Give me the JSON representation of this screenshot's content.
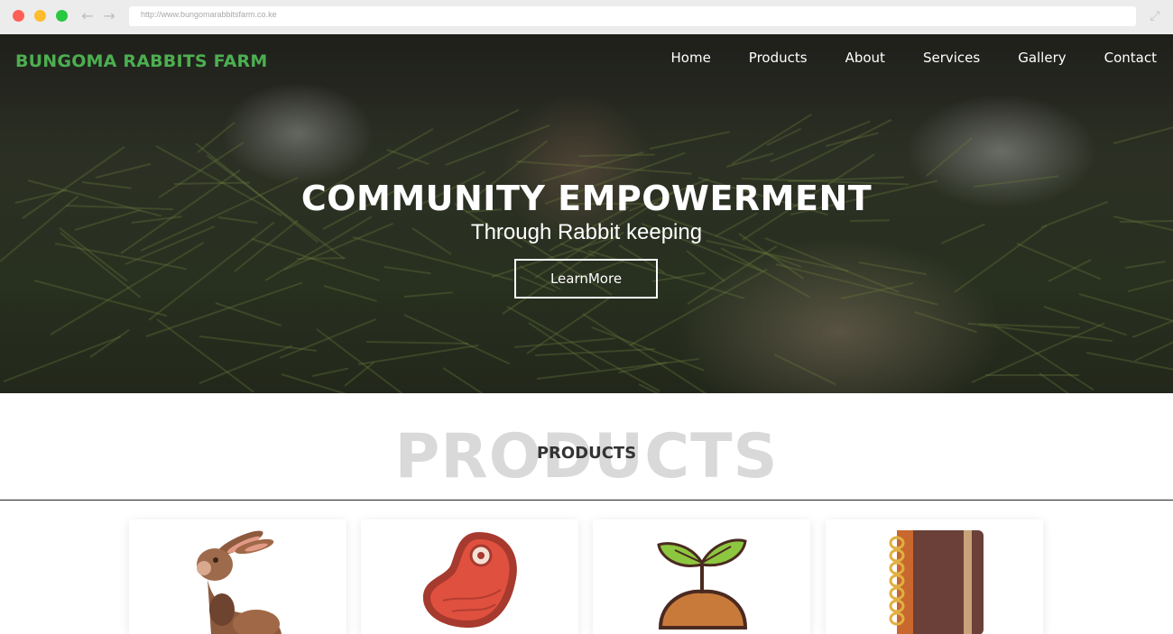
{
  "browser": {
    "url": "http://www.bungomarabbitsfarm.co.ke"
  },
  "site": {
    "brand": "BUNGOMA RABBITS FARM",
    "nav": [
      "Home",
      "Products",
      "About",
      "Services",
      "Gallery",
      "Contact"
    ]
  },
  "hero": {
    "title": "COMMUNITY EMPOWERMENT",
    "subtitle": "Through Rabbit keeping",
    "button": "LearnMore"
  },
  "products": {
    "background_title": "PRODUCTS",
    "title": "PRODUCTS",
    "cards": [
      {
        "icon": "rabbit-icon"
      },
      {
        "icon": "meat-icon"
      },
      {
        "icon": "sprout-icon"
      },
      {
        "icon": "notebook-icon"
      }
    ]
  },
  "colors": {
    "brand_green": "#4caf50",
    "heading_gray": "#d9d9d9"
  }
}
